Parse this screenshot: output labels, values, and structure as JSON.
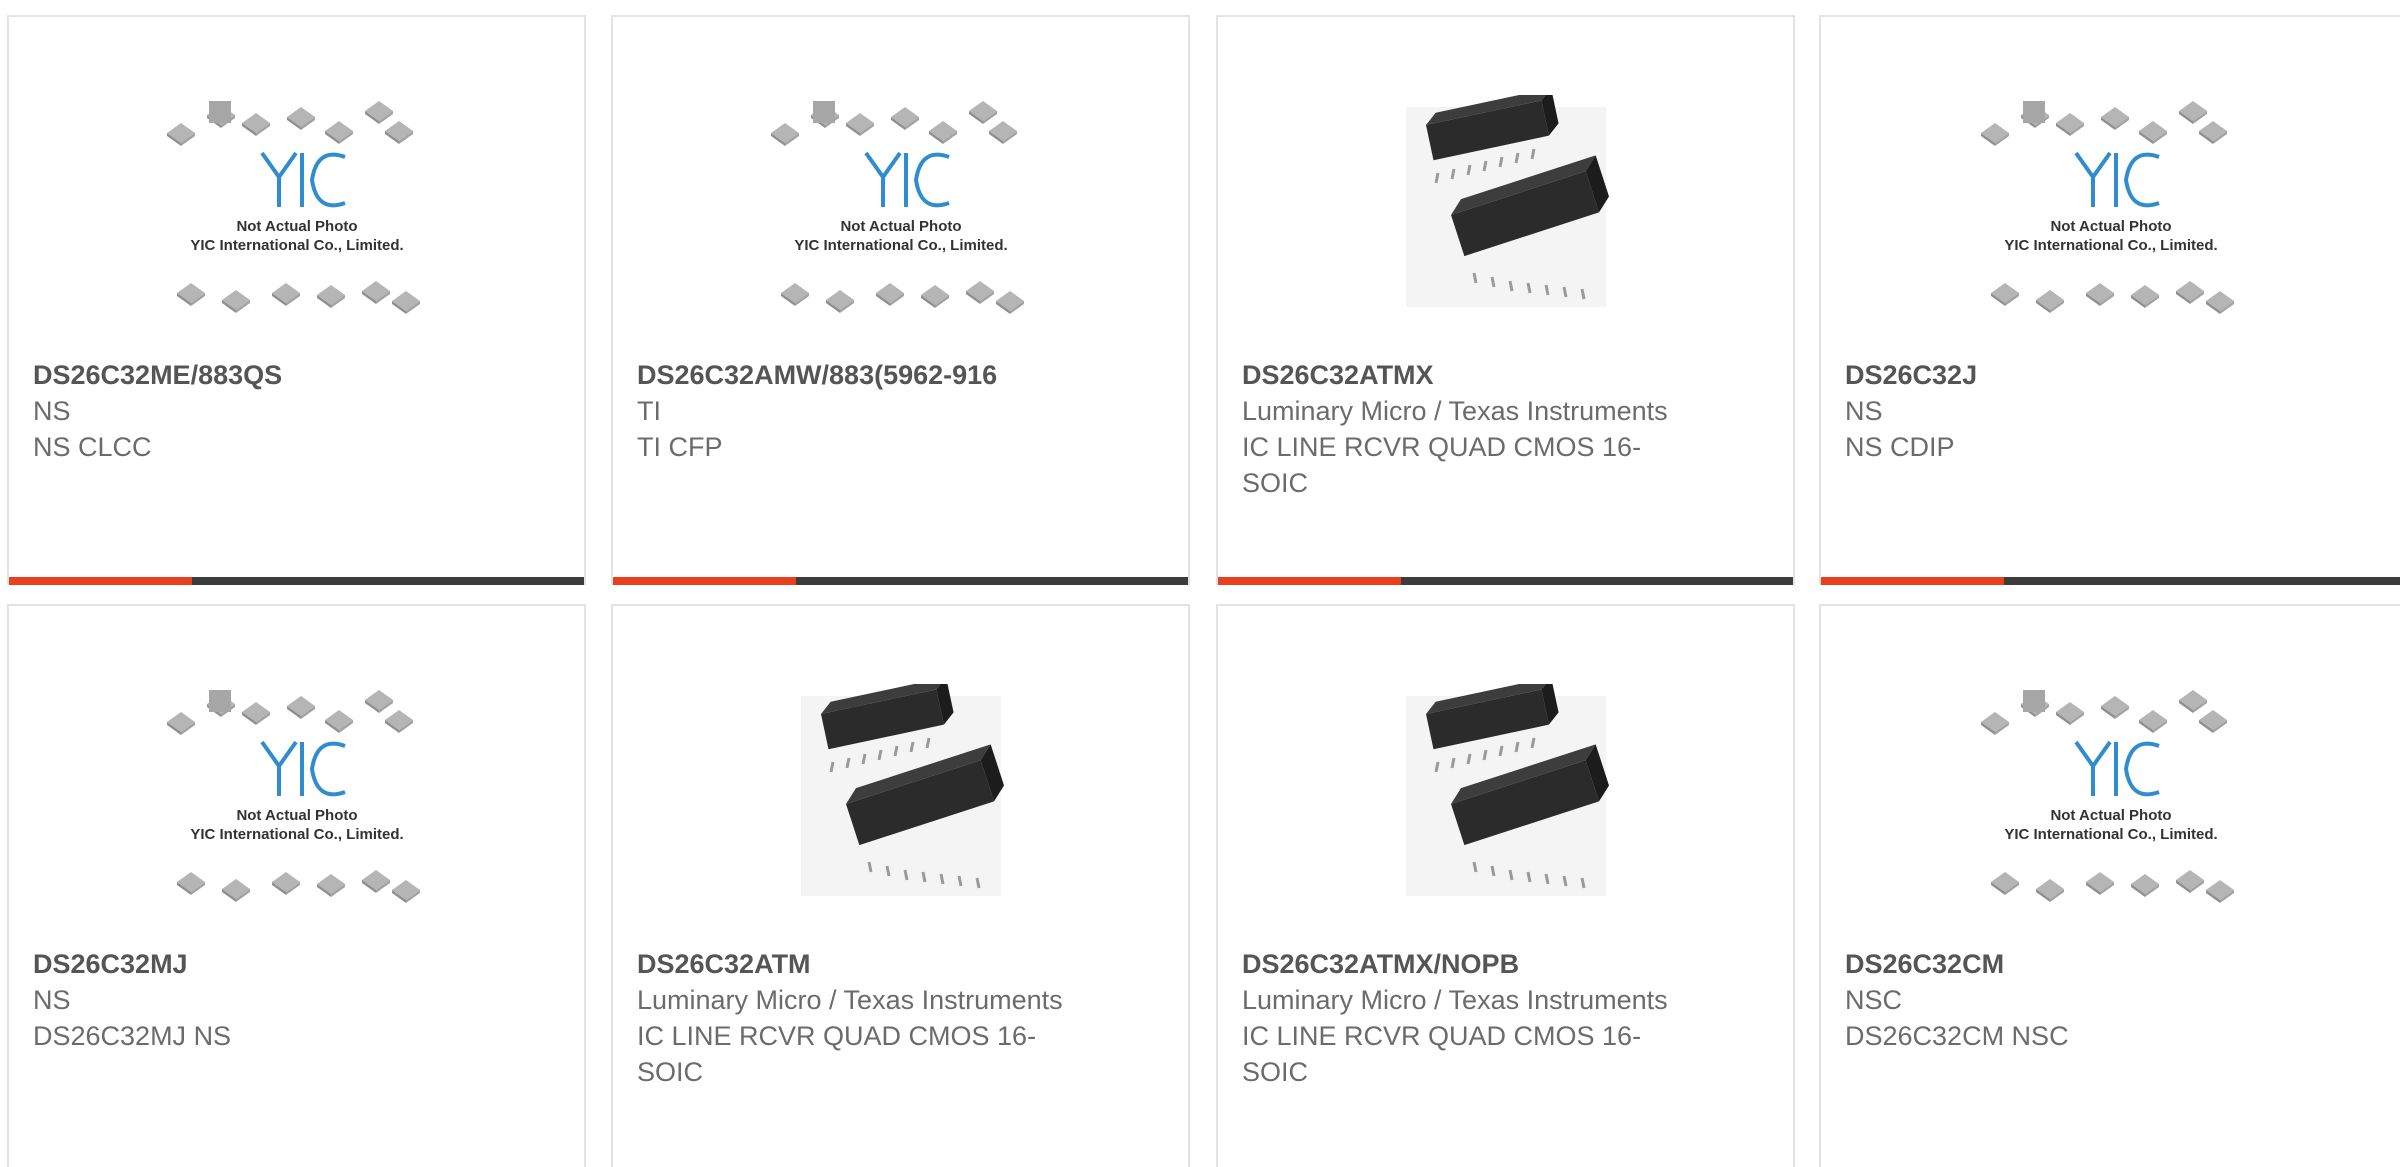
{
  "accent_color": "#e8401c",
  "bar_color": "#3c3c3c",
  "placeholder": {
    "line1": "Not Actual Photo",
    "line2": "YIC International Co., Limited."
  },
  "products": [
    {
      "part_number": "DS26C32ME/883QS",
      "manufacturer": "NS",
      "description": "NS CLCC",
      "image": "placeholder-logo"
    },
    {
      "part_number": "DS26C32AMW/883(5962-916",
      "manufacturer": "TI",
      "description": "TI CFP",
      "image": "placeholder-logo"
    },
    {
      "part_number": "DS26C32ATMX",
      "manufacturer": "Luminary Micro / Texas Instruments",
      "description": "IC LINE RCVR QUAD CMOS 16-SOIC",
      "image": "soic-chip-photo"
    },
    {
      "part_number": "DS26C32J",
      "manufacturer": "NS",
      "description": "NS CDIP",
      "image": "placeholder-logo"
    },
    {
      "part_number": "DS26C32MJ",
      "manufacturer": "NS",
      "description": "DS26C32MJ NS",
      "image": "placeholder-logo"
    },
    {
      "part_number": "DS26C32ATM",
      "manufacturer": "Luminary Micro / Texas Instruments",
      "description": "IC LINE RCVR QUAD CMOS 16-SOIC",
      "image": "soic-chip-photo"
    },
    {
      "part_number": "DS26C32ATMX/NOPB",
      "manufacturer": "Luminary Micro / Texas Instruments",
      "description": "IC LINE RCVR QUAD CMOS 16-SOIC",
      "image": "soic-chip-photo"
    },
    {
      "part_number": "DS26C32CM",
      "manufacturer": "NSC",
      "description": "DS26C32CM NSC",
      "image": "placeholder-logo"
    }
  ]
}
